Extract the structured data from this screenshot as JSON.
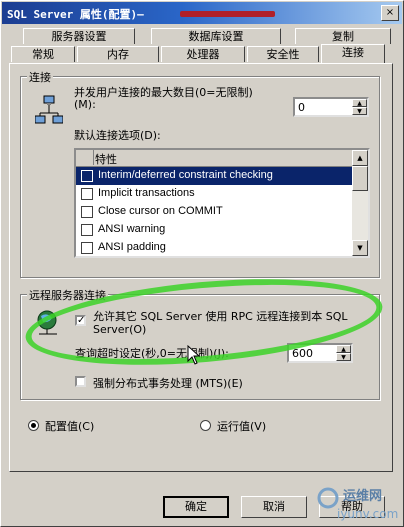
{
  "window": {
    "title": "SQL Server 属性(配置)—",
    "close_glyph": "×"
  },
  "tabs_row1": [
    "服务器设置",
    "数据库设置",
    "复制"
  ],
  "tabs_row2": [
    "常规",
    "内存",
    "处理器",
    "安全性",
    "连接"
  ],
  "connections": {
    "group_title": "连接",
    "max_label": "并发用户连接的最大数目(0=无限制)",
    "max_label_line2": "(M):",
    "max_value": "0",
    "default_options_label": "默认连接选项(D):",
    "list_header": "特性",
    "options": [
      {
        "label": "Interim/deferred constraint checking",
        "checked": false,
        "selected": true
      },
      {
        "label": "Implicit transactions",
        "checked": false,
        "selected": false
      },
      {
        "label": "Close cursor on COMMIT",
        "checked": false,
        "selected": false
      },
      {
        "label": "ANSI warning",
        "checked": false,
        "selected": false
      },
      {
        "label": "ANSI padding",
        "checked": false,
        "selected": false
      }
    ]
  },
  "remote": {
    "group_title": "远程服务器连接",
    "allow_rpc_line1": "允许其它 SQL Server 使用 RPC 远程连接到本 SQL",
    "allow_rpc_line2": "Server(O)",
    "allow_rpc_checked": true,
    "timeout_label": "查询超时设定(秒,0=无限制)(J):",
    "timeout_value": "600",
    "mts_label": "强制分布式事务处理 (MTS)(E)",
    "mts_checked": false
  },
  "radios": {
    "configured": "配置值(C)",
    "running": "运行值(V)",
    "selected": "configured"
  },
  "buttons": {
    "ok": "确定",
    "cancel": "取消",
    "help": "帮助"
  },
  "watermark": {
    "site_cn": "运维网",
    "site_url": "iyunv.com"
  },
  "colors": {
    "selection": "#0a246a",
    "highlight_ellipse": "#3cd228",
    "face": "#d4d0c8"
  }
}
